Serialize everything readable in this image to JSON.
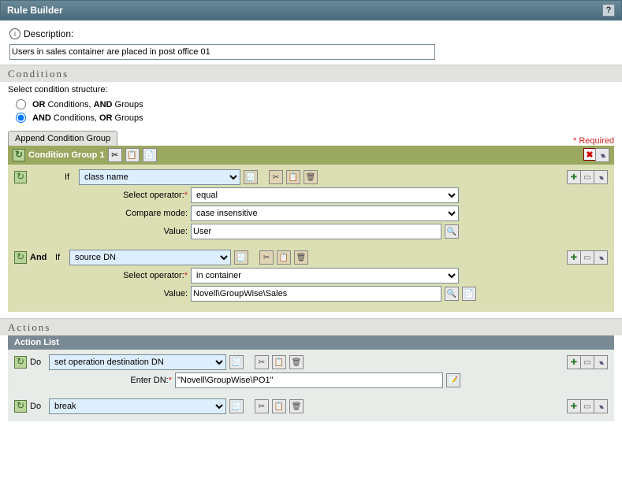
{
  "header": {
    "title": "Rule Builder"
  },
  "description": {
    "label": "Description:",
    "value": "Users in sales container are placed in post office 01"
  },
  "conditions": {
    "heading": "Conditions",
    "structure_label": "Select condition structure:",
    "option_or": "OR Conditions, AND Groups",
    "option_and": "AND Conditions, OR Groups",
    "selected": "and",
    "append_btn": "Append Condition Group",
    "required_text": "* Required",
    "group_title": "Condition Group 1",
    "cond1": {
      "prefix": "If",
      "type": "class name",
      "operator_label": "Select operator:",
      "operator": "equal",
      "mode_label": "Compare mode:",
      "mode": "case insensitive",
      "value_label": "Value:",
      "value": "User"
    },
    "cond2": {
      "join": "And",
      "prefix": "If",
      "type": "source DN",
      "operator_label": "Select operator:",
      "operator": "in container",
      "value_label": "Value:",
      "value": "Novell\\GroupWise\\Sales"
    }
  },
  "actions": {
    "heading": "Actions",
    "list_title": "Action List",
    "a1": {
      "prefix": "Do",
      "type": "set operation destination DN",
      "dn_label": "Enter DN:",
      "dn_value": "\"Novell\\GroupWise\\PO1\""
    },
    "a2": {
      "prefix": "Do",
      "type": "break"
    }
  }
}
